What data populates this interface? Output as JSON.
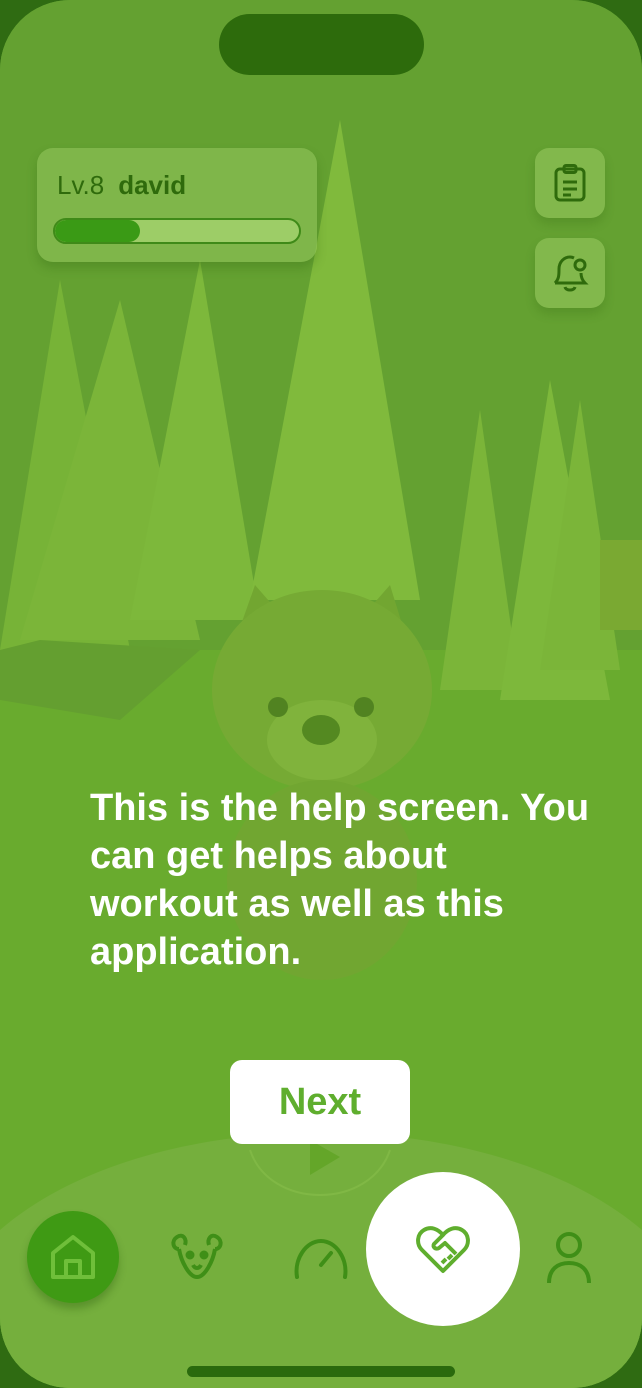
{
  "status": {
    "island": ""
  },
  "profile": {
    "level_label": "Lv.8",
    "username": "david",
    "xp_progress": 0.35
  },
  "top_actions": [
    {
      "name": "clipboard-icon"
    },
    {
      "name": "bell-icon"
    }
  ],
  "tutorial": {
    "message": "This is the help screen. You can get helps about workout as well as this application.",
    "next_label": "Next"
  },
  "nav": {
    "items": [
      {
        "name": "home",
        "icon": "home-icon"
      },
      {
        "name": "pet",
        "icon": "dog-icon"
      },
      {
        "name": "workout",
        "icon": "speedometer-icon"
      },
      {
        "name": "help",
        "icon": "heart-handshake-icon",
        "active": true
      },
      {
        "name": "profile",
        "icon": "user-icon"
      }
    ]
  },
  "colors": {
    "accent": "#5fae2e",
    "dark": "#2f6b0c",
    "overlay": "#76b034"
  }
}
